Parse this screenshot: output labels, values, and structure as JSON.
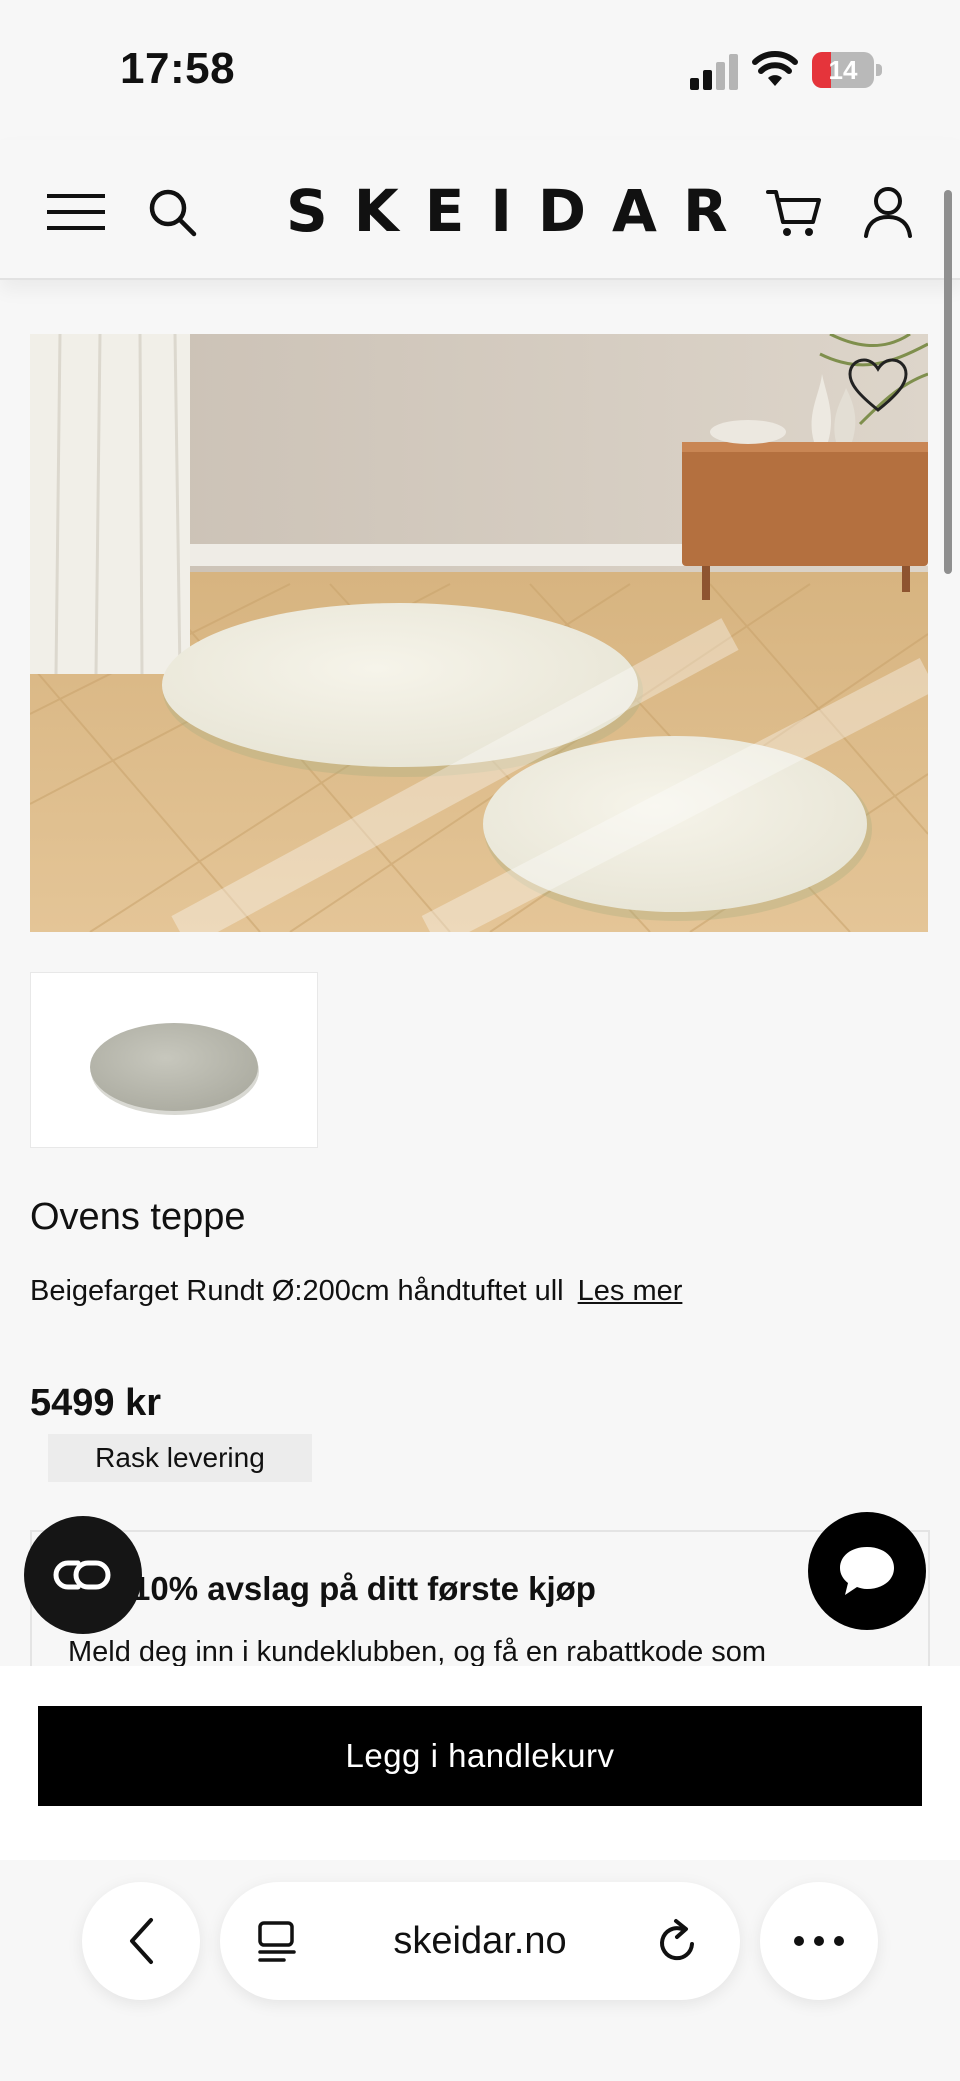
{
  "status_bar": {
    "time": "17:58",
    "battery_percent": "14",
    "battery_level": 0.14
  },
  "header": {
    "logo": "SKEIDAR"
  },
  "product": {
    "name": "Ovens teppe",
    "description": "Beigefarget Rundt Ø:200cm håndtuftet ull",
    "read_more": "Les mer",
    "price": "5499 kr",
    "delivery_badge": "Rask levering"
  },
  "promo": {
    "title": "10% avslag på ditt første kjøp",
    "text": "Meld deg inn i kundeklubben, og få en rabattkode som"
  },
  "cart_button": {
    "label": "Legg i handlekurv"
  },
  "browser": {
    "url": "skeidar.no"
  },
  "icons": {
    "menu": "menu-icon",
    "search": "search-icon",
    "cart": "cart-icon",
    "account": "user-icon",
    "wishlist": "heart-icon",
    "loyalty": "loyalty-icon",
    "chat": "chat-bubble-icon",
    "back": "chevron-left-icon",
    "reader": "reader-mode-icon",
    "reload": "reload-icon",
    "more": "more-dots-icon"
  },
  "colors": {
    "accent": "#000000",
    "battery_low": "#e5343b",
    "background": "#f7f7f7"
  }
}
